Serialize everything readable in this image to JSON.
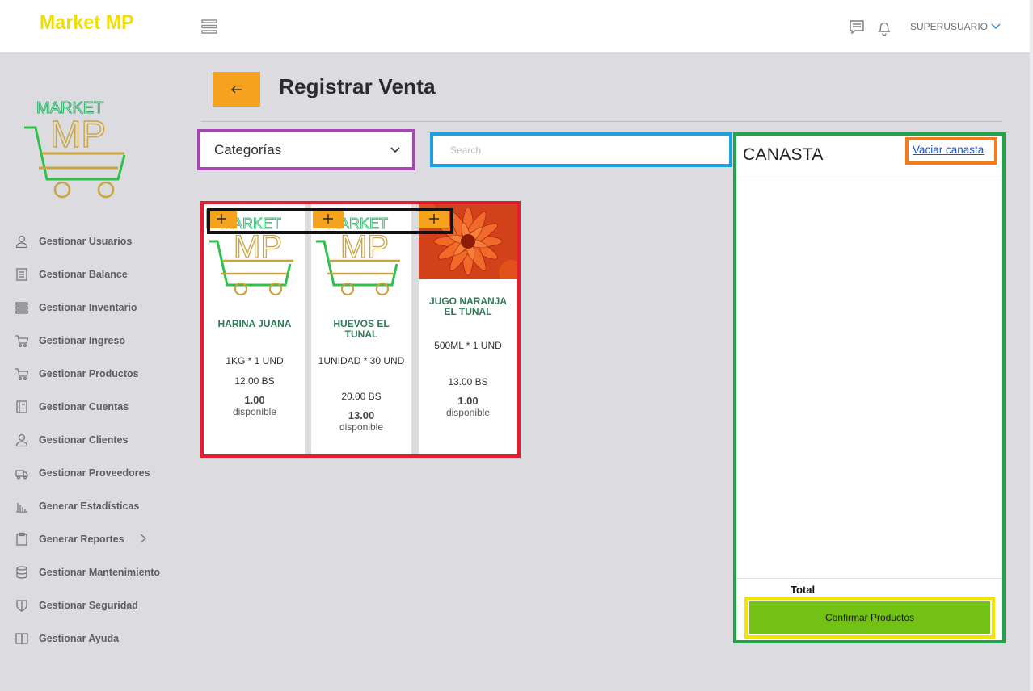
{
  "app": {
    "brand": "Market MP"
  },
  "header": {
    "menu_icon": "hamburger-icon",
    "chat_icon": "chat-icon",
    "bell_icon": "bell-icon",
    "user": "SUPERUSUARIO"
  },
  "sidebar": {
    "items": [
      {
        "label": "Gestionar Usuarios",
        "icon": "user-icon"
      },
      {
        "label": "Gestionar Balance",
        "icon": "ledger-icon"
      },
      {
        "label": "Gestionar Inventario",
        "icon": "list-icon"
      },
      {
        "label": "Gestionar Ingreso",
        "icon": "cart-icon"
      },
      {
        "label": "Gestionar Productos",
        "icon": "cart-icon"
      },
      {
        "label": "Gestionar Cuentas",
        "icon": "book-icon"
      },
      {
        "label": "Gestionar Clientes",
        "icon": "user-icon"
      },
      {
        "label": "Gestionar Proveedores",
        "icon": "truck-icon"
      },
      {
        "label": "Generar Estadísticas",
        "icon": "bar-chart-icon"
      },
      {
        "label": "Generar Reportes",
        "icon": "clipboard-icon"
      },
      {
        "label": "Gestionar Mantenimiento",
        "icon": "database-icon"
      },
      {
        "label": "Gestionar Seguridad",
        "icon": "shield-icon"
      },
      {
        "label": "Gestionar Ayuda",
        "icon": "open-book-icon"
      }
    ]
  },
  "page": {
    "title": "Registrar Venta",
    "back_icon": "arrow-left-icon"
  },
  "filters": {
    "category_label": "Categorías",
    "search_placeholder": "Search"
  },
  "products": [
    {
      "name": "HARINA JUANA",
      "desc": "1KG * 1 UND",
      "price": "12.00 BS",
      "stock": "1.00",
      "stock_label": "disponible",
      "image": "market-mp-logo"
    },
    {
      "name": "HUEVOS EL TUNAL",
      "desc": "1UNIDAD * 30 UND",
      "price": "20.00 BS",
      "stock": "13.00",
      "stock_label": "disponible",
      "image": "market-mp-logo"
    },
    {
      "name": "JUGO NARANJA EL TUNAL",
      "desc": "500ML * 1 UND",
      "price": "13.00 BS",
      "stock": "1.00",
      "stock_label": "disponible",
      "image": "orange-flower-photo"
    }
  ],
  "basket": {
    "title": "CANASTA",
    "empty_link": "Vaciar canasta",
    "total_label": "Total",
    "confirm_label": "Confirmar Productos"
  },
  "colors": {
    "accent_orange": "#f5a21e",
    "brand_yellow": "#f2dd00",
    "confirm_green": "#72c114",
    "product_name_green": "#2f7a56",
    "outline_purple": "#a24ab0",
    "outline_blue": "#1da0e0",
    "outline_red": "#e31d2e",
    "outline_green": "#1fa447",
    "outline_orange": "#f07c1e",
    "outline_yellow": "#f2e600"
  }
}
